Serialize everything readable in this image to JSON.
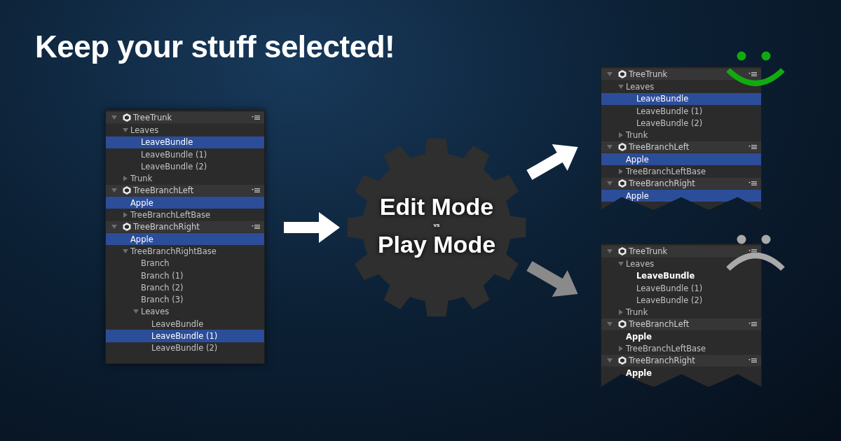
{
  "title": "Keep your stuff selected!",
  "center": {
    "line_1": "Edit Mode",
    "separator": "vs",
    "line_2": "Play Mode"
  },
  "source_panel": {
    "scenes": [
      {
        "name": "TreeTrunk",
        "expanded": true,
        "children": [
          {
            "name": "Leaves",
            "expanded": true,
            "selected": false,
            "bright": false,
            "children": [
              {
                "name": "LeaveBundle",
                "selected": true,
                "bright": false
              },
              {
                "name": "LeaveBundle (1)",
                "selected": false,
                "bright": false
              },
              {
                "name": "LeaveBundle (2)",
                "selected": false,
                "bright": false
              }
            ]
          },
          {
            "name": "Trunk",
            "expanded": false,
            "selected": false,
            "bright": false
          }
        ]
      },
      {
        "name": "TreeBranchLeft",
        "expanded": true,
        "children": [
          {
            "name": "Apple",
            "selected": true,
            "bright": false
          },
          {
            "name": "TreeBranchLeftBase",
            "expanded": false,
            "selected": false,
            "bright": false
          }
        ]
      },
      {
        "name": "TreeBranchRight",
        "expanded": true,
        "children": [
          {
            "name": "Apple",
            "selected": true,
            "bright": false
          },
          {
            "name": "TreeBranchRightBase",
            "expanded": true,
            "selected": false,
            "bright": false,
            "children": [
              {
                "name": "Branch",
                "selected": false,
                "bright": false
              },
              {
                "name": "Branch (1)",
                "selected": false,
                "bright": false
              },
              {
                "name": "Branch (2)",
                "selected": false,
                "bright": false
              },
              {
                "name": "Branch (3)",
                "selected": false,
                "bright": false
              },
              {
                "name": "Leaves",
                "expanded": true,
                "selected": false,
                "bright": false,
                "children": [
                  {
                    "name": "LeaveBundle",
                    "selected": false,
                    "bright": false
                  },
                  {
                    "name": "LeaveBundle (1)",
                    "selected": true,
                    "bright": false
                  },
                  {
                    "name": "LeaveBundle (2)",
                    "selected": false,
                    "bright": false
                  }
                ]
              }
            ]
          }
        ]
      }
    ]
  },
  "outcomes": [
    {
      "kind": "happy",
      "panel": {
        "scenes": [
          {
            "name": "TreeTrunk",
            "expanded": true,
            "children": [
              {
                "name": "Leaves",
                "expanded": true,
                "selected": false,
                "bright": false,
                "children": [
                  {
                    "name": "LeaveBundle",
                    "selected": true,
                    "bright": false
                  },
                  {
                    "name": "LeaveBundle (1)",
                    "selected": false,
                    "bright": false
                  },
                  {
                    "name": "LeaveBundle (2)",
                    "selected": false,
                    "bright": false
                  }
                ]
              },
              {
                "name": "Trunk",
                "expanded": false,
                "selected": false,
                "bright": false
              }
            ]
          },
          {
            "name": "TreeBranchLeft",
            "expanded": true,
            "children": [
              {
                "name": "Apple",
                "selected": true,
                "bright": false
              },
              {
                "name": "TreeBranchLeftBase",
                "expanded": false,
                "selected": false,
                "bright": false
              }
            ]
          },
          {
            "name": "TreeBranchRight",
            "expanded": true,
            "children": [
              {
                "name": "Apple",
                "selected": true,
                "bright": false
              }
            ]
          }
        ]
      }
    },
    {
      "kind": "sad",
      "panel": {
        "scenes": [
          {
            "name": "TreeTrunk",
            "expanded": true,
            "children": [
              {
                "name": "Leaves",
                "expanded": true,
                "selected": false,
                "bright": false,
                "children": [
                  {
                    "name": "LeaveBundle",
                    "selected": false,
                    "bright": true
                  },
                  {
                    "name": "LeaveBundle (1)",
                    "selected": false,
                    "bright": false
                  },
                  {
                    "name": "LeaveBundle (2)",
                    "selected": false,
                    "bright": false
                  }
                ]
              },
              {
                "name": "Trunk",
                "expanded": false,
                "selected": false,
                "bright": false
              }
            ]
          },
          {
            "name": "TreeBranchLeft",
            "expanded": true,
            "children": [
              {
                "name": "Apple",
                "selected": false,
                "bright": true
              },
              {
                "name": "TreeBranchLeftBase",
                "expanded": false,
                "selected": false,
                "bright": false
              }
            ]
          },
          {
            "name": "TreeBranchRight",
            "expanded": true,
            "children": [
              {
                "name": "Apple",
                "selected": false,
                "bright": true
              }
            ]
          }
        ]
      }
    }
  ]
}
